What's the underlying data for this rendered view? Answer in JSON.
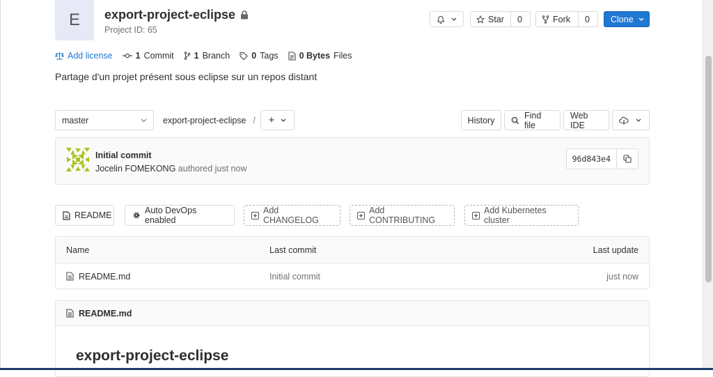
{
  "project": {
    "avatar_letter": "E",
    "name": "export-project-eclipse",
    "id_text": "Project ID: 65"
  },
  "header_actions": {
    "star_label": "Star",
    "star_count": "0",
    "fork_label": "Fork",
    "fork_count": "0",
    "clone_label": "Clone"
  },
  "stats": {
    "add_license": "Add license",
    "commits_count": "1",
    "commits_label": "Commit",
    "branches_count": "1",
    "branches_label": "Branch",
    "tags_count": "0",
    "tags_label": "Tags",
    "size_value": "0 Bytes",
    "size_label": "Files"
  },
  "description": "Partage d'un projet présent sous eclipse sur un repos distant",
  "repo_nav": {
    "branch": "master",
    "breadcrumb": "export-project-eclipse",
    "separator": "/",
    "add_symbol": "+",
    "history": "History",
    "find_file": "Find file",
    "web_ide": "Web IDE"
  },
  "last_commit": {
    "title": "Initial commit",
    "author": "Jocelin FOMEKONG",
    "authored_text": "authored just now",
    "sha": "96d843e4"
  },
  "quick_actions": {
    "readme": "README",
    "auto_devops": "Auto DevOps enabled",
    "add_changelog": "Add CHANGELOG",
    "add_contributing": "Add CONTRIBUTING",
    "add_k8s": "Add Kubernetes cluster"
  },
  "file_table": {
    "headers": {
      "name": "Name",
      "last_commit": "Last commit",
      "last_update": "Last update"
    },
    "rows": [
      {
        "name": "README.md",
        "last_commit": "Initial commit",
        "last_update": "just now"
      }
    ]
  },
  "readme": {
    "filename": "README.md",
    "heading": "export-project-eclipse"
  },
  "colors": {
    "primary": "#1f78d1",
    "identicon": "#a6c51e"
  }
}
